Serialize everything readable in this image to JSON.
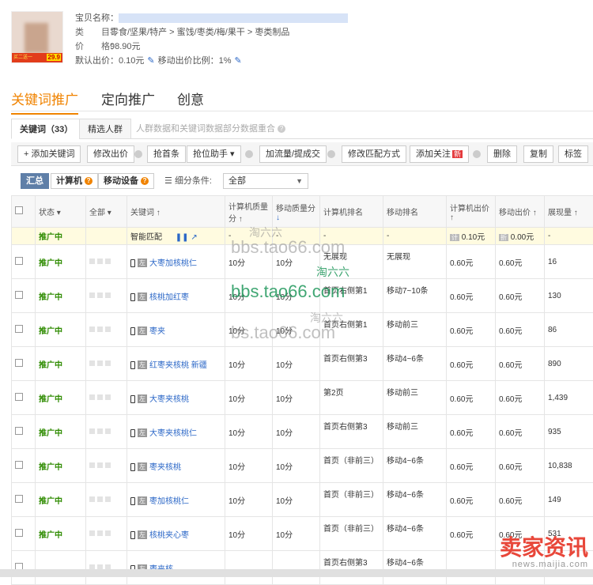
{
  "product": {
    "promo_text": "买二送一",
    "price_tag": "29.9",
    "name_label": "宝贝名称：",
    "category_label": "类　　目：",
    "category": "零食/坚果/特产 > 蜜饯/枣类/梅/果干 > 枣类制品",
    "price_label": "价　　格：",
    "price": "98.90元",
    "default_bid_label": "默认出价：",
    "default_bid": "0.10元",
    "mobile_ratio_label": "移动出价比例：",
    "mobile_ratio": "1%"
  },
  "tabs": [
    "关键词推广",
    "定向推广",
    "创意"
  ],
  "subtabs": {
    "keywords": "关键词（33）",
    "crowd": "精选人群",
    "note": "人群数据和关键词数据部分数据重合"
  },
  "toolbar": [
    "+ 添加关键词",
    "修改出价",
    "抢首条",
    "抢位助手 ▾",
    "加流量/提成交",
    "修改匹配方式",
    "添加关注",
    "删除",
    "复制",
    "标签"
  ],
  "toolbar_new": "新",
  "filter": {
    "summary": "汇总",
    "pc": "计算机",
    "mobile": "移动设备",
    "label": "细分条件:",
    "select": "全部"
  },
  "columns": [
    "状态",
    "全部",
    "关键词",
    "计算机质量分",
    "移动质量分",
    "计算机排名",
    "移动排名",
    "计算机出价",
    "移动出价",
    "展现量"
  ],
  "smart_row": {
    "status": "推广中",
    "keyword": "智能匹配",
    "pc_q": "-",
    "m_q": "-",
    "pc_rank": "-",
    "m_rank": "-",
    "pc_bid": "0.10元",
    "m_bid": "0.00元",
    "impr": "-"
  },
  "rows": [
    {
      "status": "推广中",
      "keyword": "大枣加核桃仁",
      "pc_q": "10分",
      "m_q": "10分",
      "pc_rank": "无展现",
      "m_rank": "无展现",
      "pc_bid": "0.60元",
      "m_bid": "0.60元",
      "impr": "16"
    },
    {
      "status": "推广中",
      "keyword": "核桃加红枣",
      "pc_q": "10分",
      "m_q": "10分",
      "pc_rank": "首页右侧第1",
      "m_rank": "移动7~10条",
      "pc_bid": "0.60元",
      "m_bid": "0.60元",
      "impr": "130"
    },
    {
      "status": "推广中",
      "keyword": "枣夹",
      "pc_q": "10分",
      "m_q": "10分",
      "pc_rank": "首页右侧第1",
      "m_rank": "移动前三",
      "pc_bid": "0.60元",
      "m_bid": "0.60元",
      "impr": "86"
    },
    {
      "status": "推广中",
      "keyword": "红枣夹核桃 新疆",
      "pc_q": "10分",
      "m_q": "10分",
      "pc_rank": "首页右侧第3",
      "m_rank": "移动4~6条",
      "pc_bid": "0.60元",
      "m_bid": "0.60元",
      "impr": "890"
    },
    {
      "status": "推广中",
      "keyword": "大枣夹核桃",
      "pc_q": "10分",
      "m_q": "10分",
      "pc_rank": "第2页",
      "m_rank": "移动前三",
      "pc_bid": "0.60元",
      "m_bid": "0.60元",
      "impr": "1,439"
    },
    {
      "status": "推广中",
      "keyword": "大枣夹核桃仁",
      "pc_q": "10分",
      "m_q": "10分",
      "pc_rank": "首页右侧第3",
      "m_rank": "移动前三",
      "pc_bid": "0.60元",
      "m_bid": "0.60元",
      "impr": "935"
    },
    {
      "status": "推广中",
      "keyword": "枣夹核桃",
      "pc_q": "10分",
      "m_q": "10分",
      "pc_rank": "首页（非前三）",
      "m_rank": "移动4~6条",
      "pc_bid": "0.60元",
      "m_bid": "0.60元",
      "impr": "10,838"
    },
    {
      "status": "推广中",
      "keyword": "枣加核桃仁",
      "pc_q": "10分",
      "m_q": "10分",
      "pc_rank": "首页（非前三）",
      "m_rank": "移动4~6条",
      "pc_bid": "0.60元",
      "m_bid": "0.60元",
      "impr": "149"
    },
    {
      "status": "推广中",
      "keyword": "核桃夹心枣",
      "pc_q": "10分",
      "m_q": "10分",
      "pc_rank": "首页（非前三）",
      "m_rank": "移动4~6条",
      "pc_bid": "0.60元",
      "m_bid": "0.60元",
      "impr": "531"
    },
    {
      "status": "",
      "keyword": "枣夹核",
      "pc_q": "",
      "m_q": "",
      "pc_rank": "首页右侧第3",
      "m_rank": "移动4~6条",
      "pc_bid": "",
      "m_bid": "",
      "impr": ""
    }
  ],
  "watermarks": [
    "淘六六",
    "bbs.tao66.com",
    "淘六六",
    "bbs.tao66.com",
    "淘六六",
    "bs.tao66.com"
  ],
  "brand": {
    "big": "卖家资讯",
    "small": "news.maijia.com"
  }
}
